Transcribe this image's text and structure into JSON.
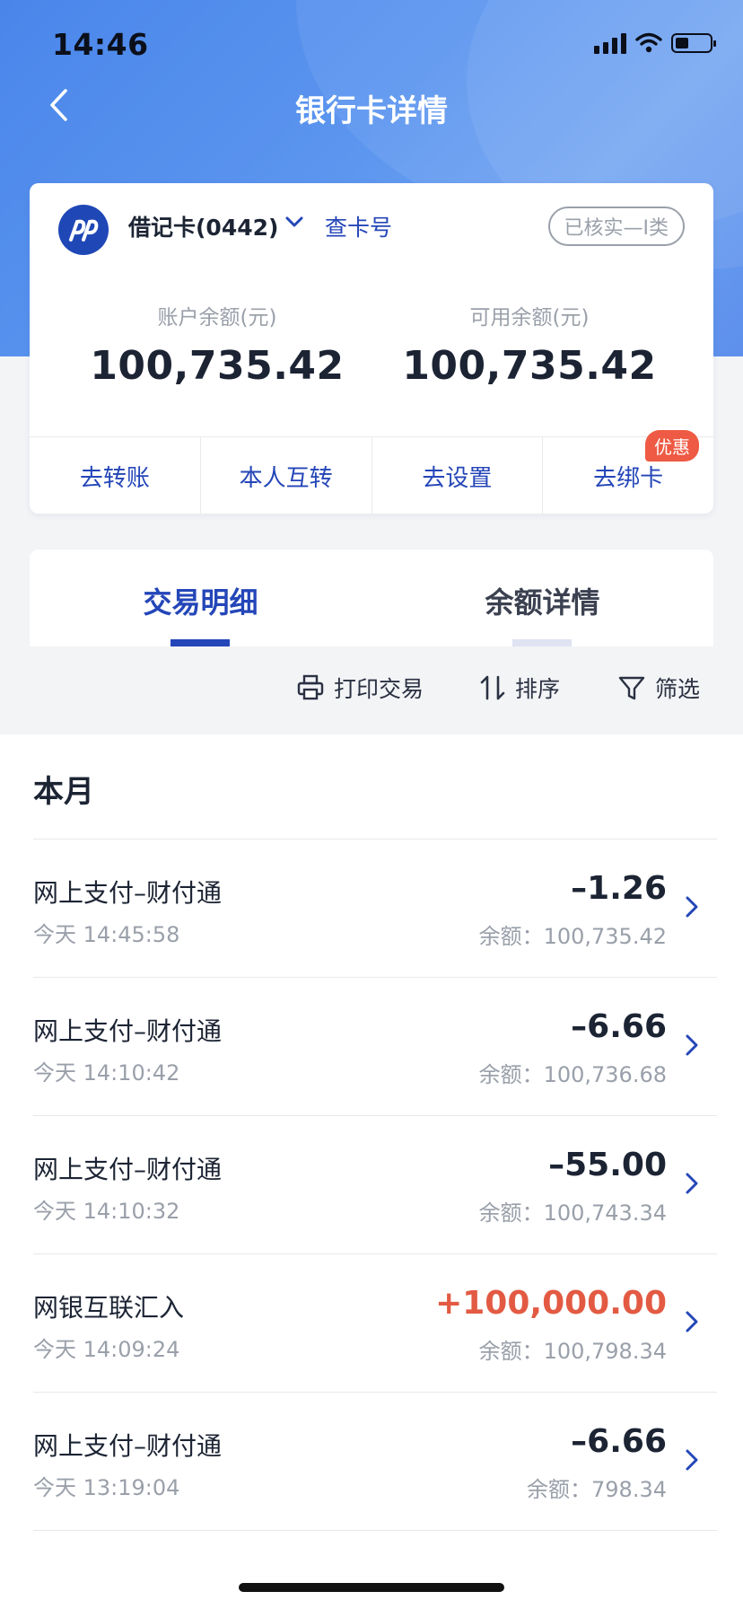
{
  "status_bar": {
    "time": "14:46",
    "battery_level": 0.4
  },
  "nav": {
    "title": "银行卡详情",
    "back_icon": "chevron-left-icon"
  },
  "card": {
    "type_label": "借记卡(0442)",
    "view_card_number": "查卡号",
    "verified_badge": "已核实—I类",
    "account_balance_label": "账户余额(元)",
    "account_balance": "100,735.42",
    "available_balance_label": "可用余额(元)",
    "available_balance": "100,735.42",
    "actions": [
      {
        "label": "去转账"
      },
      {
        "label": "本人互转"
      },
      {
        "label": "去设置"
      },
      {
        "label": "去绑卡",
        "badge": "优惠"
      }
    ]
  },
  "tabs": [
    {
      "label": "交易明细",
      "active": true
    },
    {
      "label": "余额详情",
      "active": false
    }
  ],
  "tools": {
    "print": "打印交易",
    "sort": "排序",
    "filter": "筛选"
  },
  "list": {
    "month_header": "本月",
    "transactions": [
      {
        "name": "网上支付–财付通",
        "date": "今天 14:45:58",
        "amount": "–1.26",
        "balance": "余额：100,735.42",
        "type": "expense"
      },
      {
        "name": "网上支付–财付通",
        "date": "今天 14:10:42",
        "amount": "–6.66",
        "balance": "余额：100,736.68",
        "type": "expense"
      },
      {
        "name": "网上支付–财付通",
        "date": "今天 14:10:32",
        "amount": "–55.00",
        "balance": "余额：100,743.34",
        "type": "expense"
      },
      {
        "name": "网银互联汇入",
        "date": "今天 14:09:24",
        "amount": "+100,000.00",
        "balance": "余额：100,798.34",
        "type": "income"
      },
      {
        "name": "网上支付–财付通",
        "date": "今天 13:19:04",
        "amount": "–6.66",
        "balance": "余额：798.34",
        "type": "expense"
      }
    ]
  },
  "colors": {
    "accent": "#2446b8",
    "income": "#e35a43",
    "header": "#4a86ea"
  }
}
